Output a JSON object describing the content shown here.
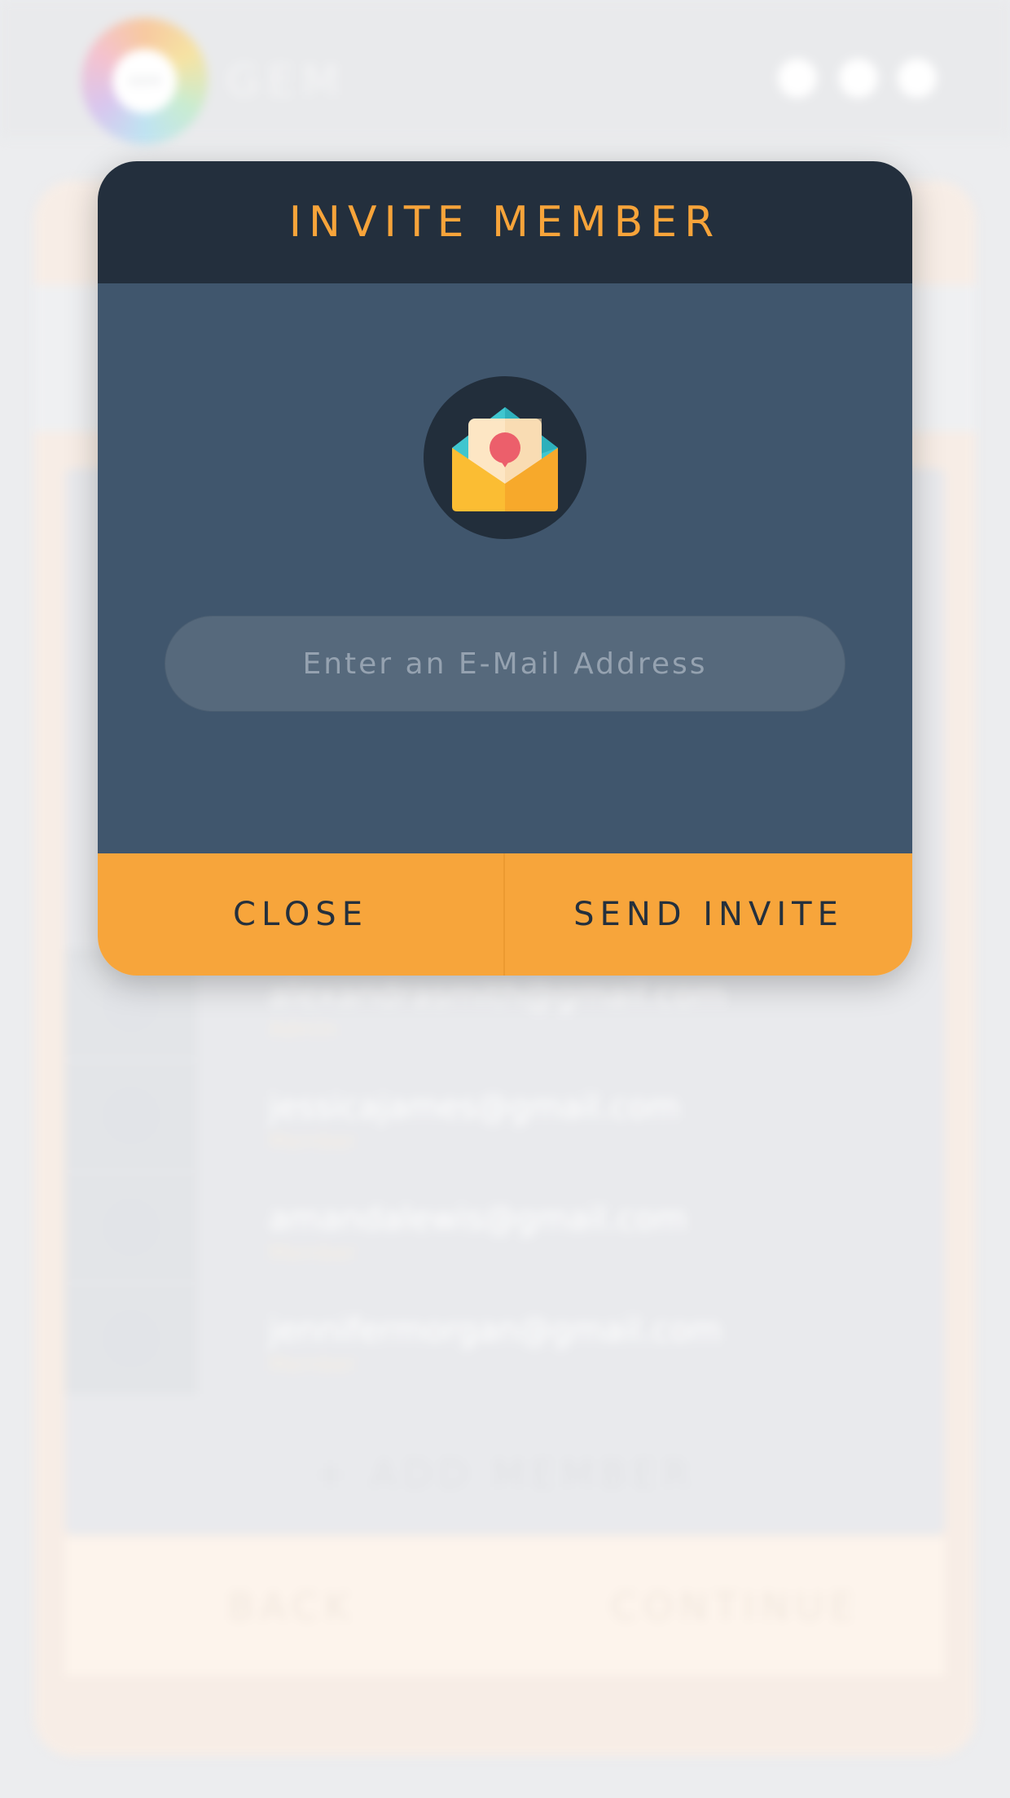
{
  "app": {
    "logo_badge": "GEM",
    "logo_text": "GEM"
  },
  "background": {
    "members": [
      {
        "email": "alexandrasmith@gmail.com",
        "role": "Admin"
      },
      {
        "email": "jessicajames@gmail.com",
        "role": "Member"
      },
      {
        "email": "amandalewis@gmail.com",
        "role": "Member"
      },
      {
        "email": "jennifermorgan@gmail.com",
        "role": "Member"
      }
    ],
    "add_member_label": "+ ADD MEMBER",
    "back_label": "BACK",
    "continue_label": "CONTINUE"
  },
  "modal": {
    "title": "INVITE MEMBER",
    "icon": "envelope-invitation-icon",
    "email_placeholder": "Enter an E-Mail Address",
    "email_value": "",
    "close_label": "CLOSE",
    "send_label": "SEND INVITE"
  },
  "colors": {
    "header_bg": "#232f3d",
    "body_bg": "#40566d",
    "accent": "#f7a53b",
    "input_bg": "#56697c"
  }
}
